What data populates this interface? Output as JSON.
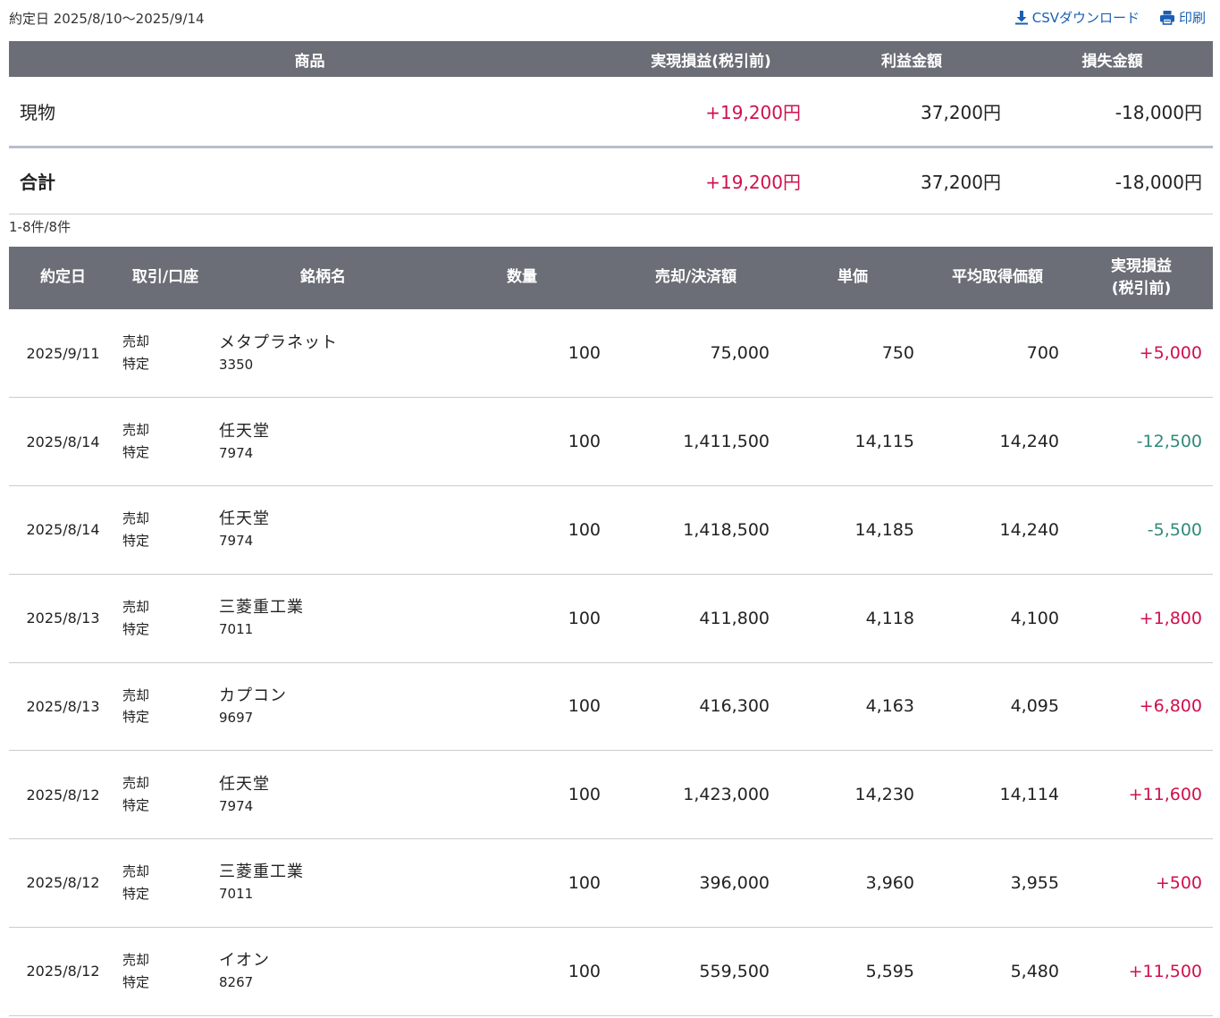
{
  "header": {
    "period_label": "約定日 2025/8/10〜2025/9/14",
    "csv_label": "CSVダウンロード",
    "print_label": "印刷"
  },
  "summary": {
    "columns": [
      "商品",
      "実現損益(税引前)",
      "利益金額",
      "損失金額"
    ],
    "rows": [
      {
        "name": "現物",
        "pl": "+19,200円",
        "profit": "37,200円",
        "loss": "-18,000円"
      }
    ],
    "total": {
      "name": "合計",
      "pl": "+19,200円",
      "profit": "37,200円",
      "loss": "-18,000円"
    }
  },
  "count_label": "1-8件/8件",
  "trades": {
    "columns": {
      "date": "約定日",
      "account": "取引/口座",
      "stock": "銘柄名",
      "qty": "数量",
      "amount": "売却/決済額",
      "price": "単価",
      "avg": "平均取得価額",
      "pl_line1": "実現損益",
      "pl_line2": "(税引前)"
    },
    "rows": [
      {
        "date": "2025/9/11",
        "type": "売却",
        "account": "特定",
        "name": "メタプラネット",
        "code": "3350",
        "qty": "100",
        "amount": "75,000",
        "price": "750",
        "avg": "700",
        "pl": "+5,000"
      },
      {
        "date": "2025/8/14",
        "type": "売却",
        "account": "特定",
        "name": "任天堂",
        "code": "7974",
        "qty": "100",
        "amount": "1,411,500",
        "price": "14,115",
        "avg": "14,240",
        "pl": "-12,500"
      },
      {
        "date": "2025/8/14",
        "type": "売却",
        "account": "特定",
        "name": "任天堂",
        "code": "7974",
        "qty": "100",
        "amount": "1,418,500",
        "price": "14,185",
        "avg": "14,240",
        "pl": "-5,500"
      },
      {
        "date": "2025/8/13",
        "type": "売却",
        "account": "特定",
        "name": "三菱重工業",
        "code": "7011",
        "qty": "100",
        "amount": "411,800",
        "price": "4,118",
        "avg": "4,100",
        "pl": "+1,800"
      },
      {
        "date": "2025/8/13",
        "type": "売却",
        "account": "特定",
        "name": "カプコン",
        "code": "9697",
        "qty": "100",
        "amount": "416,300",
        "price": "4,163",
        "avg": "4,095",
        "pl": "+6,800"
      },
      {
        "date": "2025/8/12",
        "type": "売却",
        "account": "特定",
        "name": "任天堂",
        "code": "7974",
        "qty": "100",
        "amount": "1,423,000",
        "price": "14,230",
        "avg": "14,114",
        "pl": "+11,600"
      },
      {
        "date": "2025/8/12",
        "type": "売却",
        "account": "特定",
        "name": "三菱重工業",
        "code": "7011",
        "qty": "100",
        "amount": "396,000",
        "price": "3,960",
        "avg": "3,955",
        "pl": "+500"
      },
      {
        "date": "2025/8/12",
        "type": "売却",
        "account": "特定",
        "name": "イオン",
        "code": "8267",
        "qty": "100",
        "amount": "559,500",
        "price": "5,595",
        "avg": "5,480",
        "pl": "+11,500"
      }
    ]
  },
  "colors": {
    "header_bg": "#6b6e76",
    "positive": "#d0104c",
    "negative": "#2f8a7a",
    "link": "#1a5fb4",
    "summary_divider": "#b8bfcc"
  }
}
